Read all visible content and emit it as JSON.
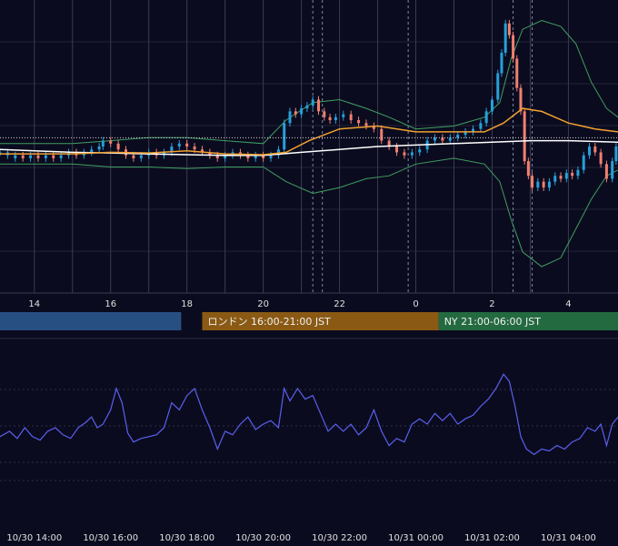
{
  "colors": {
    "background": "#0b0b1f",
    "grid": "#23233a",
    "vline": "#3a3a52",
    "candle_up": "#26a0da",
    "candle_down": "#f08070",
    "sma_short": "#f0a030",
    "sma_long": "#ffffff",
    "bollinger": "#3fa060",
    "rsi_line": "#5a60ee",
    "session_tokyo": "#284f82",
    "session_london": "#8a5a14",
    "session_ny": "#246a40",
    "text": "#e0e0e0"
  },
  "price_axis_labels": [
    "14",
    "16",
    "18",
    "20",
    "22",
    "0",
    "2",
    "4"
  ],
  "sessions": [
    {
      "name": "tokyo",
      "label": ""
    },
    {
      "name": "london",
      "label": "ロンドン 16:00-21:00 JST"
    },
    {
      "name": "ny",
      "label": "NY 21:00-06:00 JST"
    }
  ],
  "time_axis_labels": [
    "10/30 14:00",
    "10/30 16:00",
    "10/30 18:00",
    "10/30 20:00",
    "10/30 22:00",
    "10/31 00:00",
    "10/31 02:00",
    "10/31 04:00"
  ],
  "chart_data": [
    {
      "type": "candlestick",
      "title": "",
      "x_hours": [
        13,
        14,
        15,
        16,
        17,
        18,
        19,
        20,
        21,
        22,
        23,
        24,
        25,
        26,
        27,
        28
      ],
      "x_tick_labels": [
        "14",
        "16",
        "18",
        "20",
        "22",
        "0",
        "2",
        "4"
      ],
      "x_range_hours": [
        13.1,
        29.3
      ],
      "y_range": [
        0,
        100
      ],
      "price": [
        [
          13.1,
          48,
          48
        ],
        [
          13.3,
          47,
          48
        ],
        [
          13.5,
          46,
          47
        ],
        [
          13.7,
          47,
          46
        ],
        [
          13.9,
          46,
          47
        ],
        [
          14.1,
          47,
          46
        ],
        [
          14.3,
          46,
          47
        ],
        [
          14.5,
          47,
          46
        ],
        [
          14.7,
          46,
          47
        ],
        [
          14.9,
          47,
          48
        ],
        [
          15.1,
          48,
          47
        ],
        [
          15.3,
          47,
          48
        ],
        [
          15.5,
          48,
          49
        ],
        [
          15.7,
          49,
          50
        ],
        [
          15.8,
          50,
          52
        ],
        [
          16.0,
          52,
          51
        ],
        [
          16.2,
          51,
          49
        ],
        [
          16.4,
          49,
          47
        ],
        [
          16.6,
          47,
          46
        ],
        [
          16.8,
          46,
          47
        ],
        [
          17.0,
          47,
          48
        ],
        [
          17.2,
          48,
          47
        ],
        [
          17.4,
          47,
          48
        ],
        [
          17.6,
          48,
          50
        ],
        [
          17.8,
          50,
          51
        ],
        [
          18.0,
          51,
          50
        ],
        [
          18.2,
          50,
          49
        ],
        [
          18.4,
          49,
          48
        ],
        [
          18.6,
          48,
          47
        ],
        [
          18.8,
          47,
          46
        ],
        [
          19.0,
          46,
          47
        ],
        [
          19.2,
          47,
          48
        ],
        [
          19.4,
          48,
          47
        ],
        [
          19.6,
          47,
          46
        ],
        [
          19.8,
          46,
          47
        ],
        [
          20.0,
          47,
          46
        ],
        [
          20.2,
          46,
          47
        ],
        [
          20.4,
          47,
          49
        ],
        [
          20.55,
          49,
          58
        ],
        [
          20.7,
          58,
          62
        ],
        [
          20.85,
          62,
          61
        ],
        [
          21.0,
          61,
          63
        ],
        [
          21.15,
          63,
          64
        ],
        [
          21.3,
          64,
          66
        ],
        [
          21.45,
          66,
          62
        ],
        [
          21.6,
          62,
          60
        ],
        [
          21.75,
          60,
          59
        ],
        [
          21.9,
          59,
          60
        ],
        [
          22.1,
          60,
          61
        ],
        [
          22.3,
          61,
          59
        ],
        [
          22.5,
          59,
          58
        ],
        [
          22.7,
          58,
          57
        ],
        [
          22.9,
          57,
          56
        ],
        [
          23.1,
          56,
          52
        ],
        [
          23.3,
          52,
          50
        ],
        [
          23.5,
          50,
          48
        ],
        [
          23.7,
          48,
          47
        ],
        [
          23.9,
          47,
          48
        ],
        [
          24.1,
          48,
          49
        ],
        [
          24.3,
          49,
          52
        ],
        [
          24.5,
          52,
          53
        ],
        [
          24.7,
          53,
          52
        ],
        [
          24.9,
          52,
          53
        ],
        [
          25.1,
          53,
          54
        ],
        [
          25.3,
          54,
          55
        ],
        [
          25.5,
          55,
          56
        ],
        [
          25.7,
          56,
          58
        ],
        [
          25.85,
          58,
          62
        ],
        [
          26.0,
          62,
          66
        ],
        [
          26.15,
          66,
          75
        ],
        [
          26.25,
          75,
          82
        ],
        [
          26.35,
          82,
          92
        ],
        [
          26.45,
          92,
          88
        ],
        [
          26.55,
          88,
          80
        ],
        [
          26.65,
          80,
          70
        ],
        [
          26.75,
          70,
          62
        ],
        [
          26.85,
          62,
          45
        ],
        [
          26.95,
          45,
          40
        ],
        [
          27.05,
          40,
          36
        ],
        [
          27.2,
          36,
          38
        ],
        [
          27.35,
          38,
          36
        ],
        [
          27.5,
          36,
          38
        ],
        [
          27.65,
          38,
          40
        ],
        [
          27.8,
          40,
          39
        ],
        [
          27.95,
          39,
          41
        ],
        [
          28.1,
          41,
          40
        ],
        [
          28.25,
          40,
          42
        ],
        [
          28.4,
          42,
          47
        ],
        [
          28.55,
          47,
          50
        ],
        [
          28.7,
          50,
          48
        ],
        [
          28.85,
          48,
          44
        ],
        [
          29.0,
          44,
          39
        ],
        [
          29.15,
          39,
          45
        ],
        [
          29.25,
          45,
          50
        ]
      ],
      "sma_short": [
        [
          13.1,
          47.5
        ],
        [
          15,
          47.5
        ],
        [
          16,
          48
        ],
        [
          17,
          47.8
        ],
        [
          18,
          48.5
        ],
        [
          19,
          47.5
        ],
        [
          20,
          47.2
        ],
        [
          20.6,
          48
        ],
        [
          21.2,
          52
        ],
        [
          22,
          56
        ],
        [
          23,
          57
        ],
        [
          24,
          55
        ],
        [
          25,
          55
        ],
        [
          25.8,
          55
        ],
        [
          26.3,
          58
        ],
        [
          26.8,
          63
        ],
        [
          27.3,
          62
        ],
        [
          28,
          58
        ],
        [
          28.7,
          56
        ],
        [
          29.3,
          55
        ]
      ],
      "sma_long": [
        [
          13.1,
          49
        ],
        [
          14,
          48.5
        ],
        [
          15,
          48
        ],
        [
          16,
          47.8
        ],
        [
          17,
          47.5
        ],
        [
          18,
          47.2
        ],
        [
          19,
          47
        ],
        [
          20,
          47
        ],
        [
          21,
          48
        ],
        [
          22,
          49
        ],
        [
          23,
          50
        ],
        [
          24,
          50.5
        ],
        [
          25,
          51
        ],
        [
          26,
          51.5
        ],
        [
          27,
          52
        ],
        [
          28,
          52
        ],
        [
          29.3,
          51.5
        ]
      ],
      "bollinger_upper": [
        [
          13.1,
          51
        ],
        [
          14,
          51
        ],
        [
          15,
          51
        ],
        [
          16,
          52
        ],
        [
          17,
          53
        ],
        [
          18,
          53
        ],
        [
          19,
          52
        ],
        [
          20,
          51
        ],
        [
          20.6,
          59
        ],
        [
          21.3,
          65
        ],
        [
          22,
          66
        ],
        [
          22.7,
          63
        ],
        [
          23.3,
          60
        ],
        [
          24,
          56
        ],
        [
          25,
          57
        ],
        [
          25.8,
          60
        ],
        [
          26.2,
          65
        ],
        [
          26.5,
          80
        ],
        [
          26.8,
          90
        ],
        [
          27.3,
          93
        ],
        [
          27.8,
          91
        ],
        [
          28.2,
          85
        ],
        [
          28.6,
          72
        ],
        [
          29,
          63
        ],
        [
          29.3,
          60
        ]
      ],
      "bollinger_lower": [
        [
          13.1,
          44
        ],
        [
          14,
          44
        ],
        [
          15,
          44
        ],
        [
          16,
          43
        ],
        [
          17,
          43
        ],
        [
          18,
          42.5
        ],
        [
          19,
          43
        ],
        [
          20,
          43
        ],
        [
          20.6,
          38
        ],
        [
          21.3,
          34
        ],
        [
          22,
          36
        ],
        [
          22.7,
          39
        ],
        [
          23.3,
          40
        ],
        [
          24,
          44
        ],
        [
          25,
          46
        ],
        [
          25.8,
          44
        ],
        [
          26.2,
          38
        ],
        [
          26.5,
          25
        ],
        [
          26.8,
          14
        ],
        [
          27.3,
          9
        ],
        [
          27.8,
          12
        ],
        [
          28.2,
          22
        ],
        [
          28.6,
          32
        ],
        [
          29,
          40
        ],
        [
          29.3,
          42
        ]
      ],
      "current_price": 53
    },
    {
      "type": "line",
      "title": "",
      "x_range_hours": [
        13.1,
        29.3
      ],
      "y_range": [
        0,
        100
      ],
      "series": [
        {
          "points": [
            [
              13.1,
              45
            ],
            [
              13.35,
              48
            ],
            [
              13.55,
              44
            ],
            [
              13.75,
              50
            ],
            [
              13.95,
              45
            ],
            [
              14.15,
              43
            ],
            [
              14.35,
              48
            ],
            [
              14.55,
              50
            ],
            [
              14.75,
              46
            ],
            [
              14.95,
              44
            ],
            [
              15.15,
              50
            ],
            [
              15.35,
              53
            ],
            [
              15.5,
              56
            ],
            [
              15.65,
              50
            ],
            [
              15.8,
              52
            ],
            [
              16.0,
              60
            ],
            [
              16.15,
              72
            ],
            [
              16.3,
              64
            ],
            [
              16.45,
              47
            ],
            [
              16.6,
              42
            ],
            [
              16.8,
              44
            ],
            [
              17.0,
              45
            ],
            [
              17.2,
              46
            ],
            [
              17.4,
              50
            ],
            [
              17.6,
              64
            ],
            [
              17.8,
              60
            ],
            [
              18.0,
              68
            ],
            [
              18.2,
              72
            ],
            [
              18.4,
              60
            ],
            [
              18.6,
              50
            ],
            [
              18.8,
              38
            ],
            [
              19.0,
              48
            ],
            [
              19.2,
              46
            ],
            [
              19.4,
              52
            ],
            [
              19.6,
              56
            ],
            [
              19.8,
              49
            ],
            [
              20.0,
              52
            ],
            [
              20.2,
              54
            ],
            [
              20.4,
              50
            ],
            [
              20.55,
              72
            ],
            [
              20.7,
              65
            ],
            [
              20.9,
              72
            ],
            [
              21.1,
              66
            ],
            [
              21.3,
              68
            ],
            [
              21.5,
              58
            ],
            [
              21.7,
              48
            ],
            [
              21.9,
              52
            ],
            [
              22.1,
              48
            ],
            [
              22.3,
              52
            ],
            [
              22.5,
              46
            ],
            [
              22.7,
              50
            ],
            [
              22.9,
              60
            ],
            [
              23.1,
              48
            ],
            [
              23.3,
              40
            ],
            [
              23.5,
              44
            ],
            [
              23.7,
              42
            ],
            [
              23.9,
              52
            ],
            [
              24.1,
              55
            ],
            [
              24.3,
              52
            ],
            [
              24.5,
              58
            ],
            [
              24.7,
              54
            ],
            [
              24.9,
              58
            ],
            [
              25.1,
              52
            ],
            [
              25.3,
              55
            ],
            [
              25.5,
              57
            ],
            [
              25.7,
              62
            ],
            [
              25.9,
              66
            ],
            [
              26.1,
              72
            ],
            [
              26.3,
              80
            ],
            [
              26.45,
              76
            ],
            [
              26.6,
              62
            ],
            [
              26.75,
              45
            ],
            [
              26.9,
              38
            ],
            [
              27.1,
              35
            ],
            [
              27.3,
              38
            ],
            [
              27.5,
              37
            ],
            [
              27.7,
              40
            ],
            [
              27.9,
              38
            ],
            [
              28.1,
              42
            ],
            [
              28.3,
              44
            ],
            [
              28.5,
              50
            ],
            [
              28.7,
              48
            ],
            [
              28.85,
              52
            ],
            [
              29.0,
              40
            ],
            [
              29.15,
              52
            ],
            [
              29.3,
              56
            ]
          ]
        }
      ]
    }
  ]
}
